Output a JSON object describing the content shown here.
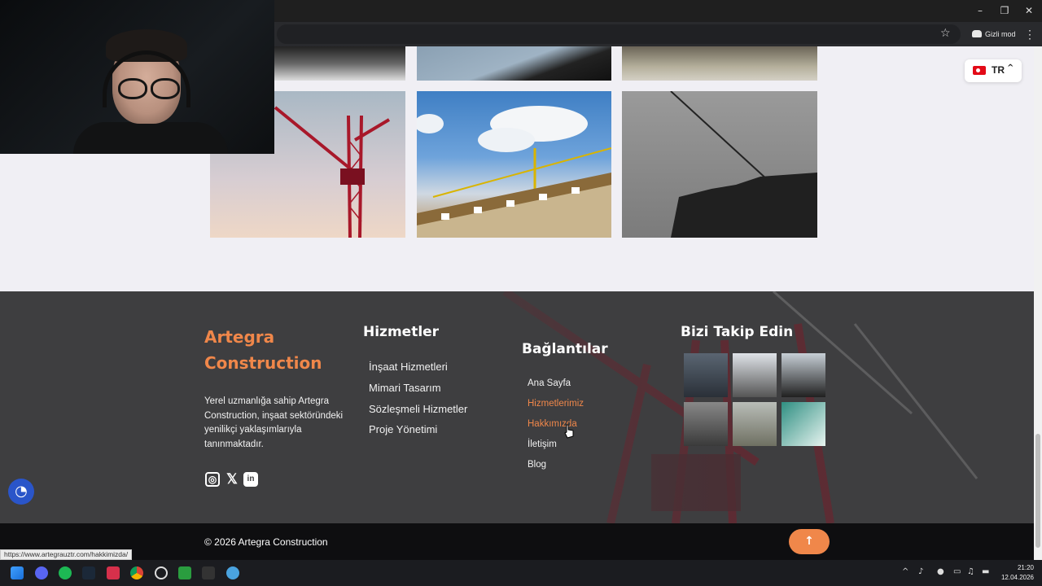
{
  "browser": {
    "incognito_label": "Gizli mod",
    "window_controls": [
      "–",
      "❐",
      "✕"
    ]
  },
  "language": {
    "code": "TR"
  },
  "gallery": {
    "image_count": 6
  },
  "footer": {
    "brand": "Artegra Construction",
    "about": "Yerel uzmanlığa sahip Artegra Construction, inşaat sektöründeki yenilikçi yaklaşımlarıyla tanınmaktadır.",
    "socials": [
      "instagram-icon",
      "x-icon",
      "linkedin-icon"
    ],
    "services_title": "Hizmetler",
    "services": [
      "İnşaat Hizmetleri",
      "Mimari Tasarım",
      "Sözleşmeli Hizmetler",
      "Proje Yönetimi"
    ],
    "links_title": "Bağlantılar",
    "links": [
      "Ana Sayfa",
      "Hizmetlerimiz",
      "Hakkımızda",
      "İletişim",
      "Blog"
    ],
    "follow_title": "Bizi Takip Edin",
    "copyright": "© 2026 Artegra Construction",
    "accent_color": "#f0874a"
  },
  "status_url": "https://www.artegrauztr.com/hakkimizda/",
  "taskbar": {
    "time": "21:20",
    "date": "12.04.2026"
  }
}
